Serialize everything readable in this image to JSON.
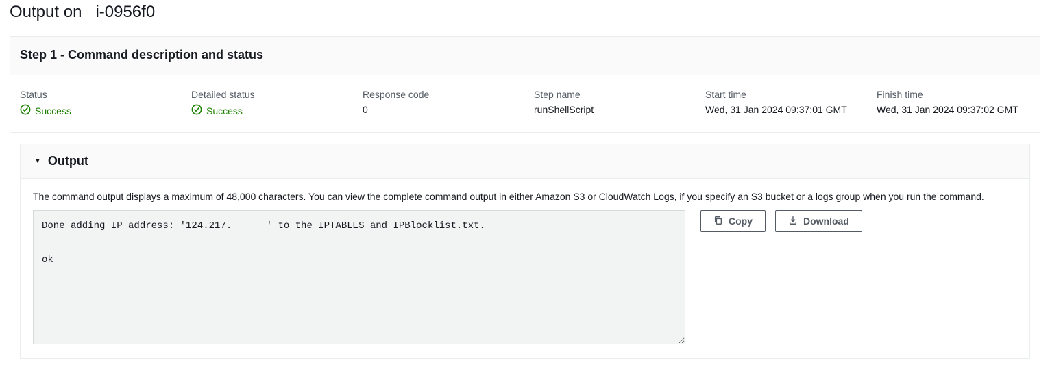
{
  "header": {
    "title_prefix": "Output on",
    "instance_id": "i-0956f0"
  },
  "step": {
    "title": "Step 1  - Command description and status",
    "fields": {
      "status": {
        "label": "Status",
        "value": "Success"
      },
      "detailed_status": {
        "label": "Detailed status",
        "value": "Success"
      },
      "response_code": {
        "label": "Response code",
        "value": "0"
      },
      "step_name": {
        "label": "Step name",
        "value": "runShellScript"
      },
      "start_time": {
        "label": "Start time",
        "value": "Wed, 31 Jan 2024 09:37:01 GMT"
      },
      "finish_time": {
        "label": "Finish time",
        "value": "Wed, 31 Jan 2024 09:37:02 GMT"
      }
    }
  },
  "output": {
    "section_title": "Output",
    "description": "The command output displays a maximum of 48,000 characters. You can view the complete command output in either Amazon S3 or CloudWatch Logs, if you specify an S3 bucket or a logs group when you run the command.",
    "content": "Done adding IP address: '124.217.      ' to the IPTABLES and IPBlocklist.txt.\n\nok",
    "actions": {
      "copy": "Copy",
      "download": "Download"
    }
  },
  "colors": {
    "success": "#1d8102"
  }
}
